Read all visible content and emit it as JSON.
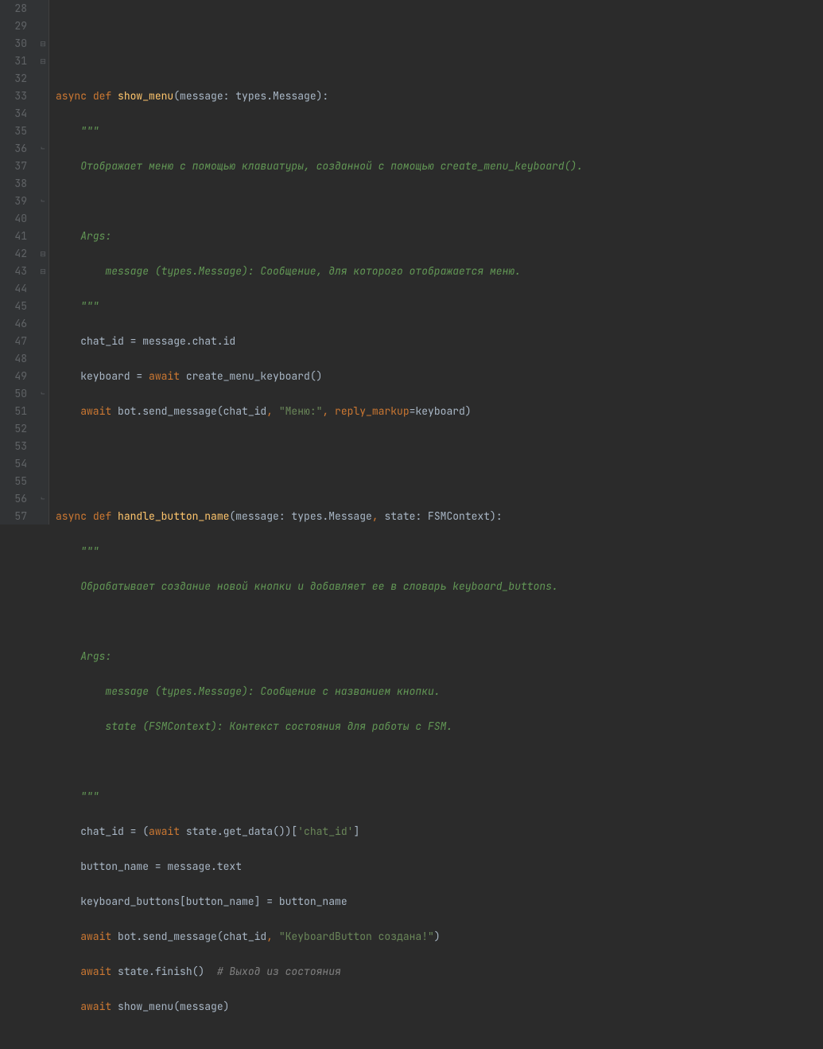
{
  "gutter": {
    "start": 28,
    "end": 57
  },
  "code": {
    "l30": {
      "kw1": "async ",
      "kw2": "def ",
      "fn": "show_menu",
      "rest1": "(message: types.Message):"
    },
    "l31": {
      "docstr": "\"\"\""
    },
    "l32": {
      "docstr": "Отображает меню с помощью клавиатуры, созданной с помощью create_menu_keyboard()."
    },
    "l34": {
      "docstr": "Args:"
    },
    "l35": {
      "docstr": "message (types.Message): Сообщение, для которого отображается меню."
    },
    "l36": {
      "docstr": "\"\"\""
    },
    "l37": {
      "txt": "chat_id = message.chat.id"
    },
    "l38": {
      "txt1": "keyboard = ",
      "kw": "await ",
      "txt2": "create_menu_keyboard()"
    },
    "l39": {
      "kw": "await ",
      "txt1": "bot.send_message(chat_id",
      "c1": ", ",
      "str1": "\"Меню:\"",
      "c2": ", ",
      "arg": "reply_markup",
      "txt2": "=keyboard)"
    },
    "l42": {
      "kw1": "async ",
      "kw2": "def ",
      "fn": "handle_button_name",
      "txt1": "(message: types.Message",
      "c1": ", ",
      "txt2": "state: FSMContext):"
    },
    "l43": {
      "docstr": "\"\"\""
    },
    "l44": {
      "docstr": "Обрабатывает создание новой кнопки и добавляет ее в словарь keyboard_buttons."
    },
    "l46": {
      "docstr": "Args:"
    },
    "l47": {
      "docstr": "message (types.Message): Сообщение с названием кнопки."
    },
    "l48": {
      "docstr": "state (FSMContext): Контекст состояния для работы с FSM."
    },
    "l50": {
      "docstr": "\"\"\""
    },
    "l51": {
      "txt1": "chat_id = (",
      "kw": "await ",
      "txt2": "state.get_data())[",
      "str": "'chat_id'",
      "txt3": "]"
    },
    "l52": {
      "txt": "button_name = message.text"
    },
    "l53": {
      "txt1": "keyboard_buttons[button_name] ",
      "txt2": "= button_name"
    },
    "l54": {
      "kw": "await ",
      "txt1": "bot.send_message(chat_id",
      "c1": ", ",
      "str": "\"KeyboardButton создана!\"",
      "txt2": ")"
    },
    "l55": {
      "kw": "await ",
      "txt1": "state.finish()  ",
      "comment": "# Выход из состояния"
    },
    "l56": {
      "kw": "await ",
      "txt": "show_menu(message)"
    }
  },
  "fold_markers": [
    {
      "line": 30,
      "type": "open"
    },
    {
      "line": 31,
      "type": "open"
    },
    {
      "line": 36,
      "type": "close"
    },
    {
      "line": 39,
      "type": "close"
    },
    {
      "line": 42,
      "type": "open"
    },
    {
      "line": 43,
      "type": "open"
    },
    {
      "line": 50,
      "type": "close"
    },
    {
      "line": 56,
      "type": "close"
    }
  ]
}
